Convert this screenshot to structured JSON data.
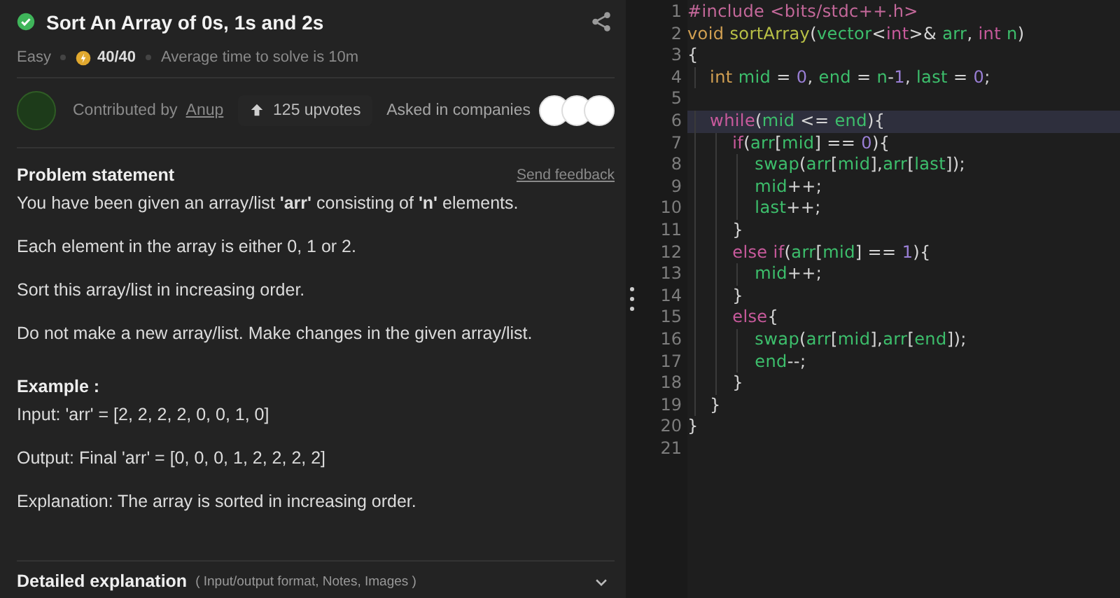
{
  "problem": {
    "title": "Sort An Array of 0s, 1s and 2s",
    "solved": true,
    "difficulty": "Easy",
    "score": "40/40",
    "avg_time": "Average time to solve is 10m",
    "contributed_label": "Contributed by",
    "contributor": "Anup",
    "upvotes": "125 upvotes",
    "companies_label": "Asked in companies",
    "statement_heading": "Problem statement",
    "feedback_link": "Send feedback",
    "paragraphs": [
      "You have been given an array/list **'arr'** consisting of **'n'** elements.",
      "Each element in the array is either 0, 1 or 2.",
      "Sort this array/list in increasing order.",
      "Do not make a new array/list. Make changes in the given array/list."
    ],
    "example_heading": "Example :",
    "example_lines": [
      "Input: 'arr' = [2, 2, 2, 2, 0, 0, 1, 0]",
      "Output: Final 'arr' = [0, 0, 0, 1, 2, 2, 2, 2]",
      "Explanation: The array is sorted in increasing order."
    ],
    "details": {
      "title": "Detailed explanation",
      "note": "( Input/output format, Notes, Images )",
      "expanded": false
    }
  },
  "editor": {
    "lines": [
      {
        "number": "1",
        "highlighted": false,
        "tokens": [
          {
            "kind": "directive",
            "text": "#include <bits/stdc++.h>"
          }
        ]
      },
      {
        "number": "2",
        "highlighted": false,
        "tokens": [
          {
            "kind": "type",
            "text": "void "
          },
          {
            "kind": "func",
            "text": "sortArray"
          },
          {
            "kind": "punct",
            "text": "("
          },
          {
            "kind": "ident",
            "text": "vector"
          },
          {
            "kind": "punct",
            "text": "<"
          },
          {
            "kind": "keyword",
            "text": "int"
          },
          {
            "kind": "punct",
            "text": ">& "
          },
          {
            "kind": "ident",
            "text": "arr"
          },
          {
            "kind": "punct",
            "text": ", "
          },
          {
            "kind": "keyword",
            "text": "int "
          },
          {
            "kind": "ident",
            "text": "n"
          },
          {
            "kind": "punct",
            "text": ")"
          }
        ]
      },
      {
        "number": "3",
        "highlighted": false,
        "tokens": [
          {
            "kind": "punct",
            "text": "{"
          }
        ]
      },
      {
        "number": "4",
        "highlighted": false,
        "tokens": [
          {
            "kind": "type",
            "text": "    int "
          },
          {
            "kind": "ident",
            "text": "mid"
          },
          {
            "kind": "punct",
            "text": " = "
          },
          {
            "kind": "number",
            "text": "0"
          },
          {
            "kind": "punct",
            "text": ", "
          },
          {
            "kind": "ident",
            "text": "end"
          },
          {
            "kind": "punct",
            "text": " = "
          },
          {
            "kind": "ident",
            "text": "n"
          },
          {
            "kind": "punct",
            "text": "-"
          },
          {
            "kind": "number",
            "text": "1"
          },
          {
            "kind": "punct",
            "text": ", "
          },
          {
            "kind": "ident",
            "text": "last"
          },
          {
            "kind": "punct",
            "text": " = "
          },
          {
            "kind": "number",
            "text": "0"
          },
          {
            "kind": "punct",
            "text": ";"
          }
        ]
      },
      {
        "number": "5"
      },
      {
        "number": "6",
        "highlighted": true,
        "tokens": [
          {
            "kind": "keyword",
            "text": "    while"
          },
          {
            "kind": "punct",
            "text": "("
          },
          {
            "kind": "ident",
            "text": "mid"
          },
          {
            "kind": "punct",
            "text": " <= "
          },
          {
            "kind": "ident",
            "text": "end"
          },
          {
            "kind": "punct",
            "text": "){"
          }
        ]
      },
      {
        "number": "7",
        "highlighted": false,
        "tokens": [
          {
            "kind": "keyword",
            "text": "        if"
          },
          {
            "kind": "punct",
            "text": "("
          },
          {
            "kind": "ident",
            "text": "arr"
          },
          {
            "kind": "punct",
            "text": "["
          },
          {
            "kind": "ident",
            "text": "mid"
          },
          {
            "kind": "punct",
            "text": "] == "
          },
          {
            "kind": "number",
            "text": "0"
          },
          {
            "kind": "punct",
            "text": "){"
          }
        ]
      },
      {
        "number": "8",
        "highlighted": false,
        "tokens": [
          {
            "kind": "ident",
            "text": "            swap"
          },
          {
            "kind": "punct",
            "text": "("
          },
          {
            "kind": "ident",
            "text": "arr"
          },
          {
            "kind": "punct",
            "text": "["
          },
          {
            "kind": "ident",
            "text": "mid"
          },
          {
            "kind": "punct",
            "text": "],"
          },
          {
            "kind": "ident",
            "text": "arr"
          },
          {
            "kind": "punct",
            "text": "["
          },
          {
            "kind": "ident",
            "text": "last"
          },
          {
            "kind": "punct",
            "text": "]);"
          }
        ]
      },
      {
        "number": "9",
        "highlighted": false,
        "tokens": [
          {
            "kind": "ident",
            "text": "            mid"
          },
          {
            "kind": "punct",
            "text": "++;"
          }
        ]
      },
      {
        "number": "10",
        "highlighted": false,
        "tokens": [
          {
            "kind": "ident",
            "text": "            last"
          },
          {
            "kind": "punct",
            "text": "++;"
          }
        ]
      },
      {
        "number": "11",
        "highlighted": false,
        "tokens": [
          {
            "kind": "punct",
            "text": "        }"
          }
        ]
      },
      {
        "number": "12",
        "highlighted": false,
        "tokens": [
          {
            "kind": "keyword",
            "text": "        else if"
          },
          {
            "kind": "punct",
            "text": "("
          },
          {
            "kind": "ident",
            "text": "arr"
          },
          {
            "kind": "punct",
            "text": "["
          },
          {
            "kind": "ident",
            "text": "mid"
          },
          {
            "kind": "punct",
            "text": "] == "
          },
          {
            "kind": "number",
            "text": "1"
          },
          {
            "kind": "punct",
            "text": "){"
          }
        ]
      },
      {
        "number": "13",
        "highlighted": false,
        "tokens": [
          {
            "kind": "ident",
            "text": "            mid"
          },
          {
            "kind": "punct",
            "text": "++;"
          }
        ]
      },
      {
        "number": "14",
        "highlighted": false,
        "tokens": [
          {
            "kind": "punct",
            "text": "        }"
          }
        ]
      },
      {
        "number": "15",
        "highlighted": false,
        "tokens": [
          {
            "kind": "keyword",
            "text": "        else"
          },
          {
            "kind": "punct",
            "text": "{"
          }
        ]
      },
      {
        "number": "16",
        "highlighted": false,
        "tokens": [
          {
            "kind": "ident",
            "text": "            swap"
          },
          {
            "kind": "punct",
            "text": "("
          },
          {
            "kind": "ident",
            "text": "arr"
          },
          {
            "kind": "punct",
            "text": "["
          },
          {
            "kind": "ident",
            "text": "mid"
          },
          {
            "kind": "punct",
            "text": "],"
          },
          {
            "kind": "ident",
            "text": "arr"
          },
          {
            "kind": "punct",
            "text": "["
          },
          {
            "kind": "ident",
            "text": "end"
          },
          {
            "kind": "punct",
            "text": "]);"
          }
        ]
      },
      {
        "number": "17",
        "highlighted": false,
        "tokens": [
          {
            "kind": "ident",
            "text": "            end"
          },
          {
            "kind": "punct",
            "text": "--;"
          }
        ]
      },
      {
        "number": "18",
        "highlighted": false,
        "tokens": [
          {
            "kind": "punct",
            "text": "        }"
          }
        ]
      },
      {
        "number": "19",
        "highlighted": false,
        "tokens": [
          {
            "kind": "punct",
            "text": "    }"
          }
        ]
      },
      {
        "number": "20",
        "highlighted": false,
        "tokens": [
          {
            "kind": "punct",
            "text": "}"
          }
        ]
      },
      {
        "number": "21"
      }
    ]
  }
}
